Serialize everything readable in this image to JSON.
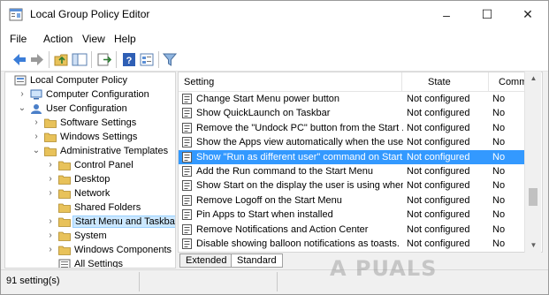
{
  "window": {
    "title": "Local Group Policy Editor",
    "controls": {
      "minimize": "–",
      "maximize": "☐",
      "close": "✕"
    }
  },
  "menu": [
    "File",
    "Action",
    "View",
    "Help"
  ],
  "toolbar_icons": [
    "back-arrow-icon",
    "forward-arrow-icon",
    "up-folder-icon",
    "show-hide-tree-icon",
    "export-list-icon",
    "help-icon",
    "properties-icon",
    "filter-icon"
  ],
  "tree": {
    "root": "Local Computer Policy",
    "computer_config": "Computer Configuration",
    "user_config": "User Configuration",
    "software_settings": "Software Settings",
    "windows_settings": "Windows Settings",
    "admin_templates": "Administrative Templates",
    "control_panel": "Control Panel",
    "desktop": "Desktop",
    "network": "Network",
    "shared_folders": "Shared Folders",
    "start_menu": "Start Menu and Taskbar",
    "system": "System",
    "windows_components": "Windows Components",
    "all_settings": "All Settings"
  },
  "list": {
    "headers": {
      "setting": "Setting",
      "state": "State",
      "comment": "Comment"
    },
    "rows": [
      {
        "setting": "Change Start Menu power button",
        "state": "Not configured",
        "comment": "No"
      },
      {
        "setting": "Show QuickLaunch on Taskbar",
        "state": "Not configured",
        "comment": "No"
      },
      {
        "setting": "Remove the \"Undock PC\" button from the Start ...",
        "state": "Not configured",
        "comment": "No"
      },
      {
        "setting": "Show the Apps view automatically when the user...",
        "state": "Not configured",
        "comment": "No"
      },
      {
        "setting": "Show \"Run as different user\" command on Start",
        "state": "Not configured",
        "comment": "No"
      },
      {
        "setting": "Add the Run command to the Start Menu",
        "state": "Not configured",
        "comment": "No"
      },
      {
        "setting": "Show Start on the display the user is using when ...",
        "state": "Not configured",
        "comment": "No"
      },
      {
        "setting": "Remove Logoff on the Start Menu",
        "state": "Not configured",
        "comment": "No"
      },
      {
        "setting": "Pin Apps to Start when installed",
        "state": "Not configured",
        "comment": "No"
      },
      {
        "setting": "Remove Notifications and Action Center",
        "state": "Not configured",
        "comment": "No"
      },
      {
        "setting": "Disable showing balloon notifications as toasts.",
        "state": "Not configured",
        "comment": "No"
      }
    ],
    "selected_index": 4
  },
  "tabs": {
    "extended": "Extended",
    "standard": "Standard",
    "active": "standard"
  },
  "status": {
    "text": "91 setting(s)"
  },
  "watermark": "A PUALS",
  "colors": {
    "selection": "#3399ff",
    "tree_selection": "#cce8ff",
    "folder": "#e8c25a"
  }
}
